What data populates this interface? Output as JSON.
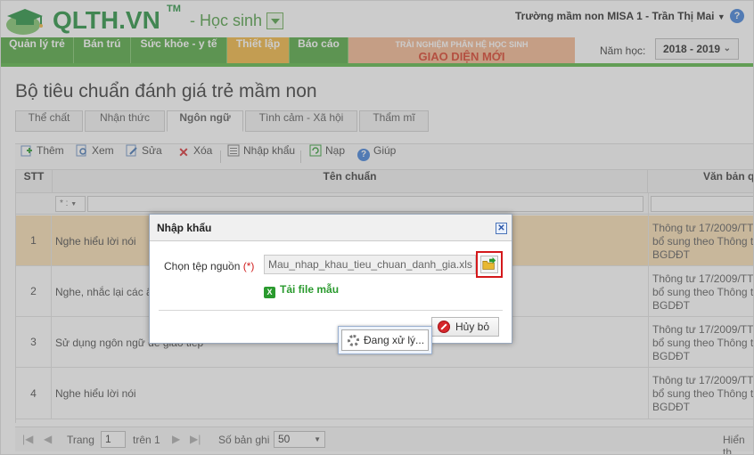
{
  "app": {
    "brand": "QLTH.VN",
    "trademark": "TM",
    "role": "- Học sinh",
    "school_user": "Trường mầm non MISA 1 - Trần Thị Mai",
    "help_glyph": "?"
  },
  "nav": {
    "tabs": [
      {
        "label": "Quản lý trẻ",
        "active": false
      },
      {
        "label": "Bán trú",
        "active": false
      },
      {
        "label": "Sức khỏe - y tế",
        "active": false
      },
      {
        "label": "Thiết lập",
        "active": true
      },
      {
        "label": "Báo cáo",
        "active": false
      }
    ],
    "banner_line1": "TRẢI NGHIỆM PHÂN HỆ HỌC SINH",
    "banner_line2": "GIAO DIỆN MỚI",
    "year_label": "Năm học:",
    "year_value": "2018 - 2019"
  },
  "page": {
    "title": "Bộ tiêu chuẩn đánh giá trẻ mầm non",
    "subtabs": [
      {
        "label": "Thể chất",
        "active": false
      },
      {
        "label": "Nhận thức",
        "active": false
      },
      {
        "label": "Ngôn ngữ",
        "active": true
      },
      {
        "label": "Tình cảm - Xã hội",
        "active": false
      },
      {
        "label": "Thẩm mĩ",
        "active": false
      }
    ]
  },
  "toolbar": {
    "add": "Thêm",
    "view": "Xem",
    "edit": "Sửa",
    "delete": "Xóa",
    "import": "Nhập khẩu",
    "load": "Nạp",
    "help": "Giúp"
  },
  "grid": {
    "col_stt": "STT",
    "col_name": "Tên chuẩn",
    "col_doc": "Văn bản q",
    "filter_op": "* :",
    "rows": [
      {
        "stt": "1",
        "name": "Nghe hiểu lời nói",
        "doc": "Thông tư 17/2009/TT\nbổ sung theo Thông t\nBGDĐT",
        "selected": true
      },
      {
        "stt": "2",
        "name": "Nghe, nhắc lại các â",
        "doc": "Thông tư 17/2009/TT\nbổ sung theo Thông t\nBGDĐT",
        "selected": false
      },
      {
        "stt": "3",
        "name": "Sử dụng ngôn ngữ để giao tiếp",
        "doc": "Thông tư 17/2009/TT\nbổ sung theo Thông t\nBGDĐT",
        "selected": false
      },
      {
        "stt": "4",
        "name": "Nghe hiểu lời nói",
        "doc": "Thông tư 17/2009/TT\nbổ sung theo Thông t\nBGDĐT",
        "selected": false
      }
    ]
  },
  "pager": {
    "page_label": "Trang",
    "page_value": "1",
    "of_label": "trên 1",
    "records_label": "Số bản ghi",
    "records_value": "50",
    "display_label": "Hiển th"
  },
  "dialog": {
    "title": "Nhập khẩu",
    "close_glyph": "✕",
    "file_label": "Chọn tệp nguồn",
    "required_mark": "(*)",
    "file_value": "Mau_nhap_khau_tieu_chuan_danh_gia.xls",
    "download_label": "Tải file mẫu",
    "cancel_label": "Hủy bỏ"
  },
  "processing": {
    "label": "Đang xử lý..."
  },
  "colors": {
    "brand_green": "#1f8f3b",
    "nav_green": "#4ca53a",
    "nav_active": "#f0b33a",
    "selected_row": "#f9ddb0",
    "highlight_red": "#d4181b"
  }
}
